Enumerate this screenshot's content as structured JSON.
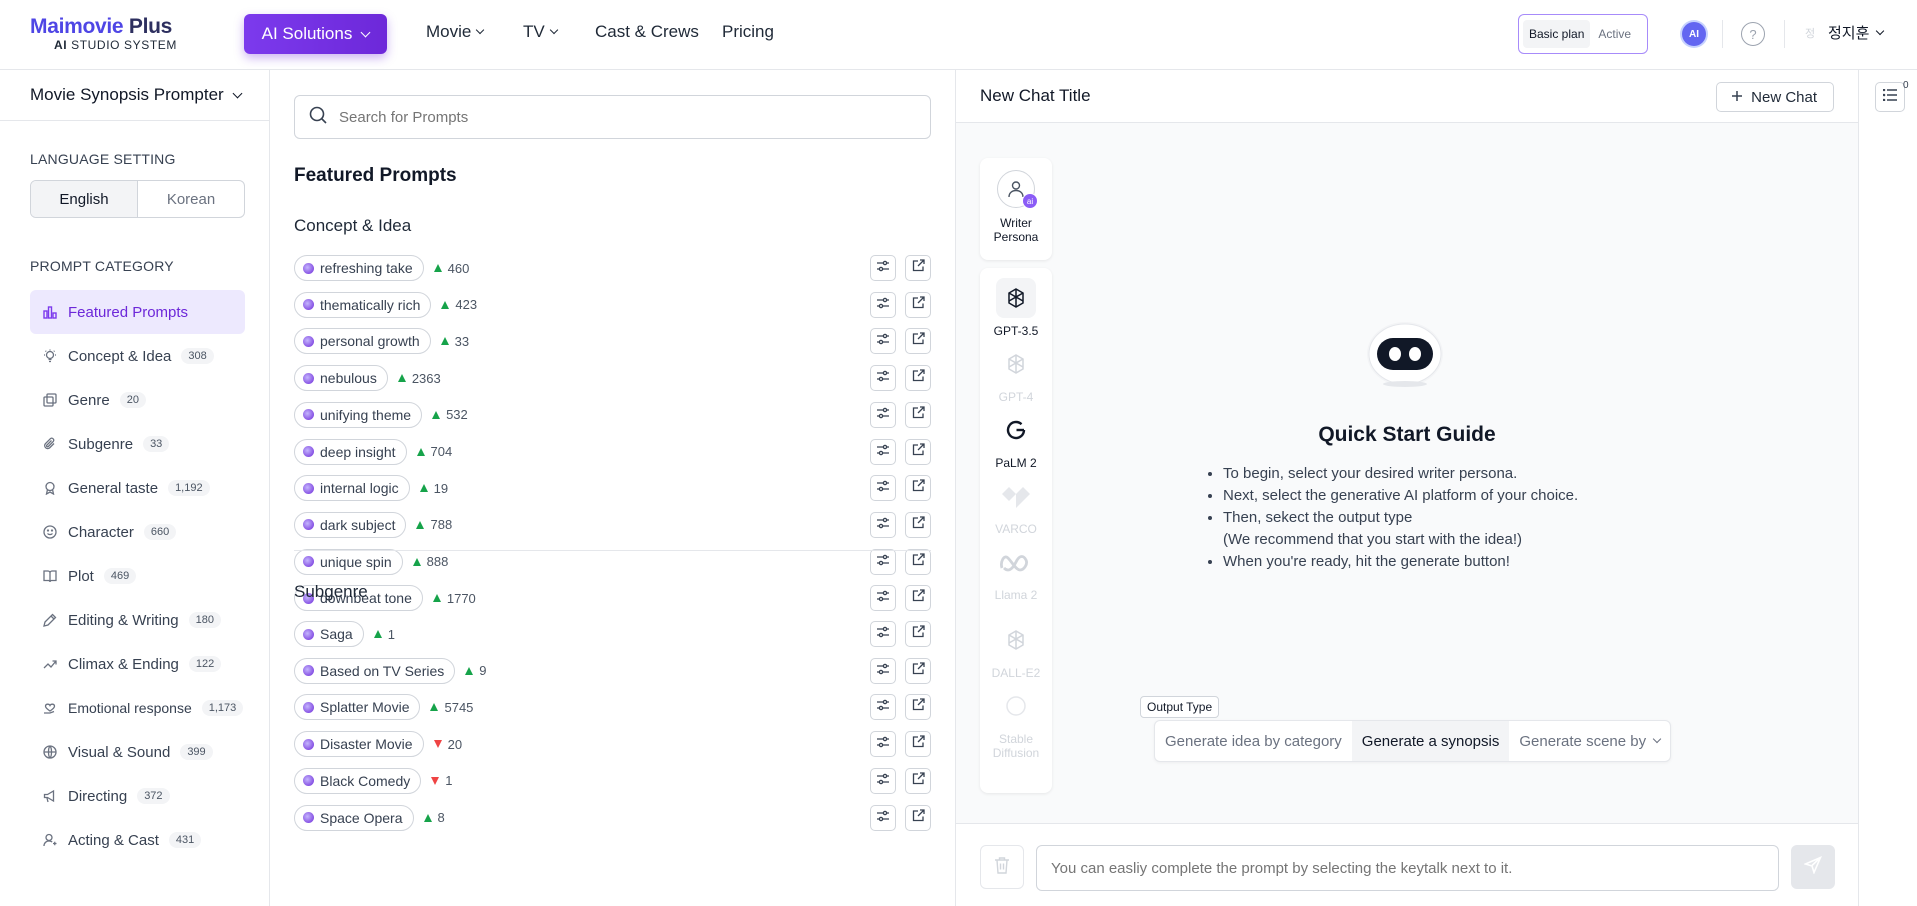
{
  "header": {
    "logo_main": "Maimovie",
    "logo_plus": "Plus",
    "logo_sub_bold": "AI",
    "logo_sub_rest": " STUDIO SYSTEM",
    "ai_solutions": "AI Solutions",
    "nav": [
      {
        "label": "Movie",
        "has_dropdown": true
      },
      {
        "label": "TV",
        "has_dropdown": true
      },
      {
        "label": "Cast & Crews",
        "has_dropdown": false
      },
      {
        "label": "Pricing",
        "has_dropdown": false
      }
    ],
    "plan_label": "Basic plan",
    "plan_status": "Active",
    "ai_badge": "AI",
    "help_glyph": "?",
    "user_avatar": "정",
    "user_name": "정지훈"
  },
  "sidebar": {
    "prompter_title": "Movie Synopsis Prompter",
    "language_heading": "LANGUAGE SETTING",
    "languages": [
      "English",
      "Korean"
    ],
    "selected_language": "English",
    "category_heading": "PROMPT CATEGORY",
    "categories": [
      {
        "label": "Featured Prompts",
        "count": "",
        "icon": "chart-icon",
        "active": true
      },
      {
        "label": "Concept & Idea",
        "count": "308",
        "icon": "bulb-icon"
      },
      {
        "label": "Genre",
        "count": "20",
        "icon": "copy-icon"
      },
      {
        "label": "Subgenre",
        "count": "33",
        "icon": "paperclip-icon"
      },
      {
        "label": "General taste",
        "count": "1,192",
        "icon": "award-icon"
      },
      {
        "label": "Character",
        "count": "660",
        "icon": "smile-icon"
      },
      {
        "label": "Plot",
        "count": "469",
        "icon": "book-icon"
      },
      {
        "label": "Editing & Writing",
        "count": "180",
        "icon": "pen-icon"
      },
      {
        "label": "Climax & Ending",
        "count": "122",
        "icon": "trend-icon"
      },
      {
        "label": "Emotional response",
        "count": "1,173",
        "icon": "heart-hand-icon"
      },
      {
        "label": "Visual & Sound",
        "count": "399",
        "icon": "globe-icon"
      },
      {
        "label": "Directing",
        "count": "372",
        "icon": "megaphone-icon"
      },
      {
        "label": "Acting & Cast",
        "count": "431",
        "icon": "user-icon"
      }
    ]
  },
  "middle": {
    "search_placeholder": "Search for Prompts",
    "featured_title": "Featured Prompts",
    "sections": [
      {
        "title": "Concept & Idea",
        "items": [
          {
            "label": "refreshing take",
            "trend": "up",
            "score": "460"
          },
          {
            "label": "thematically rich",
            "trend": "up",
            "score": "423"
          },
          {
            "label": "personal growth",
            "trend": "up",
            "score": "33"
          },
          {
            "label": "nebulous",
            "trend": "up",
            "score": "2363"
          },
          {
            "label": "unifying theme",
            "trend": "up",
            "score": "532"
          },
          {
            "label": "deep insight",
            "trend": "up",
            "score": "704"
          },
          {
            "label": "internal logic",
            "trend": "up",
            "score": "19"
          },
          {
            "label": "dark subject",
            "trend": "up",
            "score": "788"
          },
          {
            "label": "unique spin",
            "trend": "up",
            "score": "888"
          },
          {
            "label": "downbeat tone",
            "trend": "up",
            "score": "1770"
          }
        ]
      },
      {
        "title": "Subgenre",
        "items": [
          {
            "label": "Saga",
            "trend": "up",
            "score": "1"
          },
          {
            "label": "Based on TV Series",
            "trend": "up",
            "score": "9"
          },
          {
            "label": "Splatter Movie",
            "trend": "up",
            "score": "5745"
          },
          {
            "label": "Disaster Movie",
            "trend": "down",
            "score": "20"
          },
          {
            "label": "Black Comedy",
            "trend": "down",
            "score": "1"
          },
          {
            "label": "Space Opera",
            "trend": "up",
            "score": "8"
          }
        ]
      }
    ]
  },
  "chat": {
    "title": "New Chat Title",
    "new_chat_label": "New Chat",
    "persona_label": "Writer Persona",
    "persona_badge": "ai",
    "models": [
      {
        "label": "GPT-3.5",
        "icon": "openai-icon",
        "state": "selected"
      },
      {
        "label": "GPT-4",
        "icon": "openai-icon",
        "state": "disabled"
      },
      {
        "label": "PaLM 2",
        "icon": "google-icon",
        "state": "enabled"
      },
      {
        "label": "VARCO",
        "icon": "varco-icon",
        "state": "disabled"
      },
      {
        "label": "Llama 2",
        "icon": "meta-icon",
        "state": "disabled"
      },
      {
        "label": "DALL-E2",
        "icon": "openai-icon",
        "state": "disabled"
      },
      {
        "label": "Stable Diffusion",
        "icon": "circle-icon",
        "state": "disabled"
      }
    ],
    "guide_title": "Quick Start Guide",
    "guide_items": [
      "To begin, select your desired writer persona.",
      "Next, select the generative AI platform of your choice.",
      "Then, sekect the output type",
      "(We recommend that you start with the idea!)",
      "When you're ready, hit the generate button!"
    ],
    "output_type_label": "Output Type",
    "output_options": [
      {
        "label": "Generate idea by category",
        "selected": false
      },
      {
        "label": "Generate a synopsis",
        "selected": true
      },
      {
        "label": "Generate scene by",
        "selected": false,
        "dropdown": true
      }
    ],
    "input_placeholder": "You can easliy complete the prompt by selecting the keytalk next to it."
  },
  "rail": {
    "count": "0"
  },
  "colors": {
    "brand": "#4f46e5",
    "accent_purple": "#7c3aed",
    "trend_up": "#16a34a",
    "trend_down": "#ef4444"
  }
}
